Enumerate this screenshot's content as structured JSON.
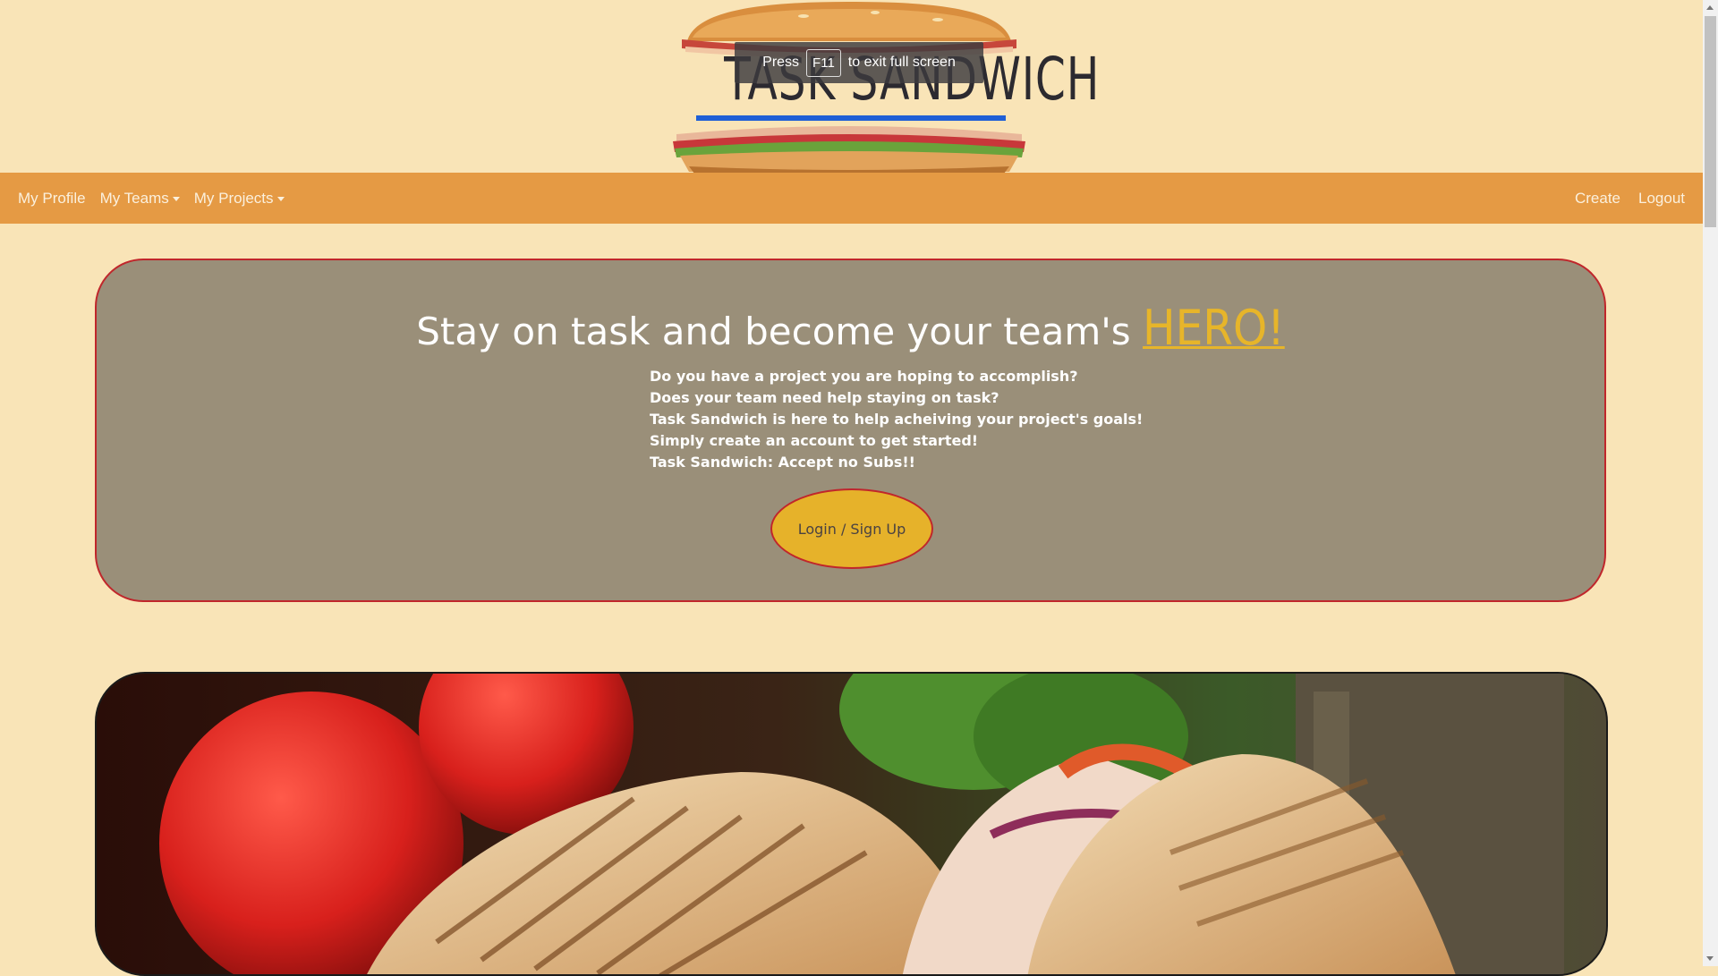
{
  "logo": {
    "title": "TASK SANDWICH"
  },
  "fullscreen_notice": {
    "prefix": "Press",
    "key": "F11",
    "suffix": "to exit full screen"
  },
  "navbar": {
    "left": [
      {
        "label": "My Profile"
      },
      {
        "label": "My Teams",
        "dropdown": true
      },
      {
        "label": "My Projects",
        "dropdown": true
      }
    ],
    "right": [
      {
        "label": "Create"
      },
      {
        "label": "Logout"
      }
    ]
  },
  "hero": {
    "heading": "Stay on task and become your team's",
    "heading_highlight": "HERO!",
    "lines": [
      "Do you have a project you are hoping to accomplish?",
      "Does your team need help staying on task?",
      "Task Sandwich is here to help acheiving your project's goals!",
      "Simply create an account to get started!",
      "Task Sandwich: Accept no Subs!!"
    ],
    "button_label": "Login / Sign Up"
  },
  "colors": {
    "page_bg": "#f9e4b7",
    "navbar_bg": "#e59a44",
    "hero_bg": "#9a8f79",
    "hero_border": "#c0262b",
    "accent_yellow": "#e6b22a",
    "logo_underline": "#1f5fd6"
  },
  "icons": {
    "dropdown": "caret-down-icon"
  }
}
